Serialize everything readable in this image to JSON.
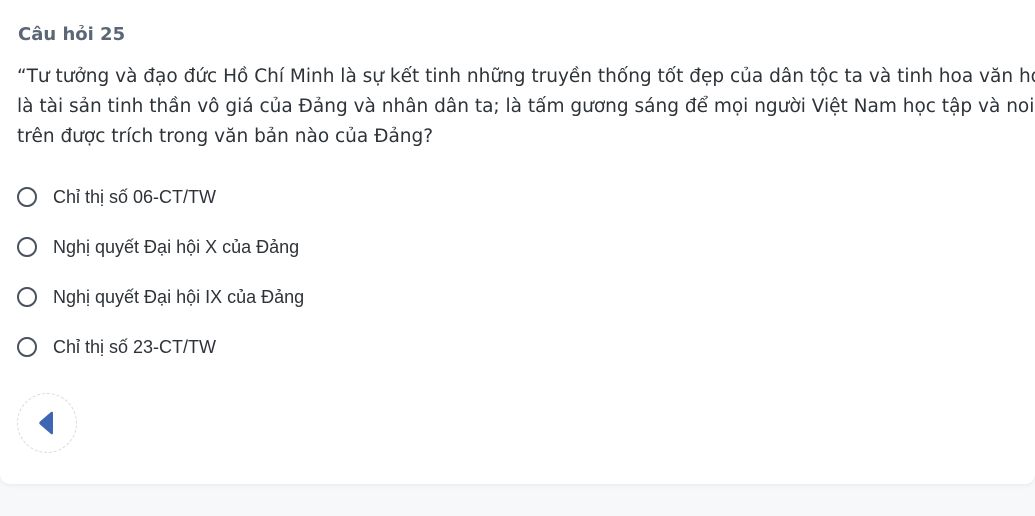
{
  "question": {
    "title": "Câu hỏi 25",
    "text_lines": [
      "“Tư tưởng và đạo đức Hồ Chí Minh là sự kết tinh những truyền thống tốt đẹp của dân tộc ta và tinh hoa văn ho",
      "là tài sản tinh thần vô giá của Đảng và nhân dân ta; là tấm gương sáng để mọi người Việt Nam học tập và noi t",
      "trên được trích trong văn bản nào của Đảng?"
    ]
  },
  "options": [
    {
      "label": "Chỉ thị số 06-CT/TW",
      "selected": false
    },
    {
      "label": "Nghị quyết Đại hội X của Đảng",
      "selected": false
    },
    {
      "label": "Nghị quyết Đại hội IX của Đảng",
      "selected": false
    },
    {
      "label": "Chỉ thị số 23-CT/TW",
      "selected": false
    }
  ],
  "navigation": {
    "prev_icon": "triangle-left-icon",
    "accent_color": "#3f66b3"
  },
  "colors": {
    "radio_border": "#4a5260",
    "title": "#5b6776",
    "text": "#2d3338"
  }
}
